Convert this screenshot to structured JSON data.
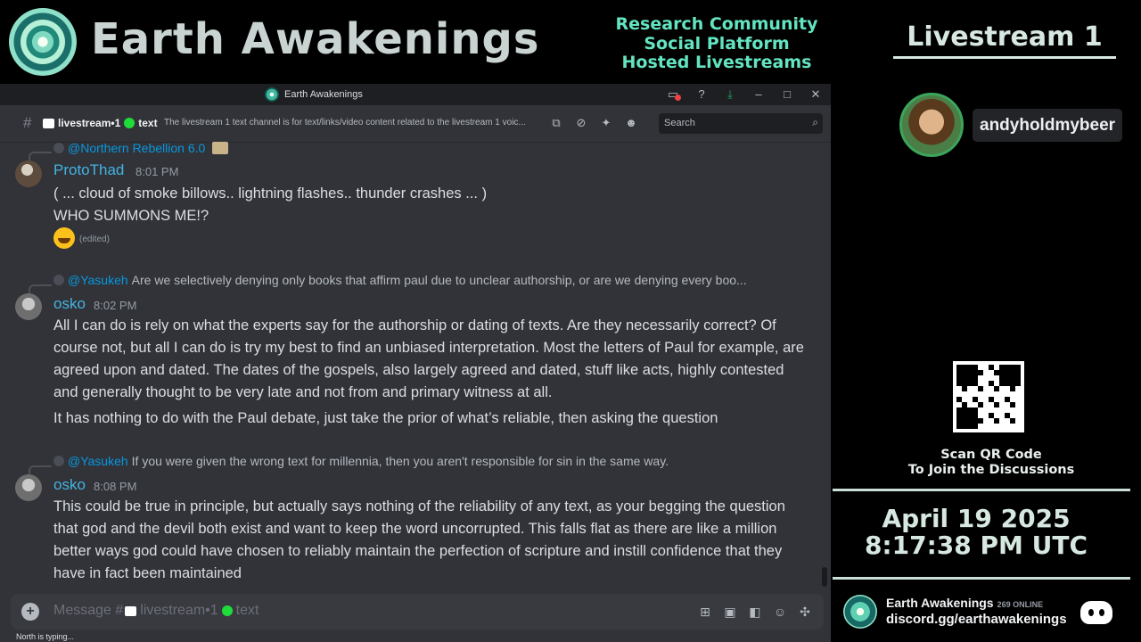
{
  "banner": {
    "title": "Earth Awakenings",
    "tagline": [
      "Research Community",
      "Social Platform",
      "Hosted Livestreams"
    ],
    "livestream": "Livestream 1"
  },
  "window": {
    "title": "Earth Awakenings",
    "icons": [
      "inbox-icon",
      "help-icon",
      "download-icon",
      "minimize-icon",
      "maximize-icon",
      "close-icon"
    ]
  },
  "channel": {
    "name": "livestream•1",
    "suffix": "text",
    "topic": "The livestream 1 text channel is for text/links/video content related to the livestream 1 voic...",
    "header_icons": [
      "threads-icon",
      "mute-icon",
      "pin-icon",
      "members-icon"
    ],
    "search_placeholder": "Search"
  },
  "messages": [
    {
      "reply_to": "@Northern Rebellion 6.0",
      "reply_text": "",
      "author": "ProtoThad",
      "time": "8:01 PM",
      "lines": [
        "( ... cloud of smoke billows.. lightning flashes.. thunder crashes ... )",
        "WHO SUMMONS ME!?"
      ],
      "edited": "(edited)"
    },
    {
      "reply_to": "@Yasukeh",
      "reply_text": "Are we selectively denying only books that affirm paul due to unclear authorship, or are we denying every boo...",
      "author": "osko",
      "time": "8:02 PM",
      "paragraph": "All I can do is rely on what the experts say for the authorship or dating of texts. Are they necessarily correct? Of course not, but all I can do is try my best to find an unbiased interpretation. Most the letters of Paul for example, are agreed upon and dated. The dates of the gospels, also largely agreed and dated, stuff like acts, highly contested and generally thought to be very late and not from and primary witness at all.",
      "followup": "It has nothing to do with the Paul debate, just take the prior of what’s reliable, then asking the question"
    },
    {
      "reply_to": "@Yasukeh",
      "reply_text": "If you were given the wrong text for millennia, then you aren't responsible for sin in the same way.",
      "author": "osko",
      "time": "8:08 PM",
      "paragraph": "This could be true in principle, but actually says nothing of the reliability of any text, as your begging the question that god and the devil both exist and want to keep the word uncorrupted. This falls flat as there are like a million better ways god could have chosen to reliably maintain the perfection of scripture and instill confidence that they have in fact been maintained"
    }
  ],
  "composer": {
    "placeholder_prefix": "Message #",
    "channel": "livestream•1",
    "suffix": "text",
    "icons": [
      "gift-icon",
      "gif-icon",
      "sticker-icon",
      "emoji-icon",
      "apps-icon"
    ]
  },
  "typing": "North is typing...",
  "sidebar": {
    "host": "andyholdmybeer",
    "scan_line1": "Scan QR Code",
    "scan_line2": "To Join the Discussions",
    "date": "April 19 2025",
    "time": "8:17:38 PM UTC",
    "server": "Earth Awakenings",
    "online": "269 ONLINE",
    "invite": "discord.gg/earthawakenings"
  },
  "colors": {
    "accent_teal": "#63e4c1",
    "mention": "#00a8fc",
    "username": "#44b3e2",
    "discord_bg": "#313338"
  }
}
